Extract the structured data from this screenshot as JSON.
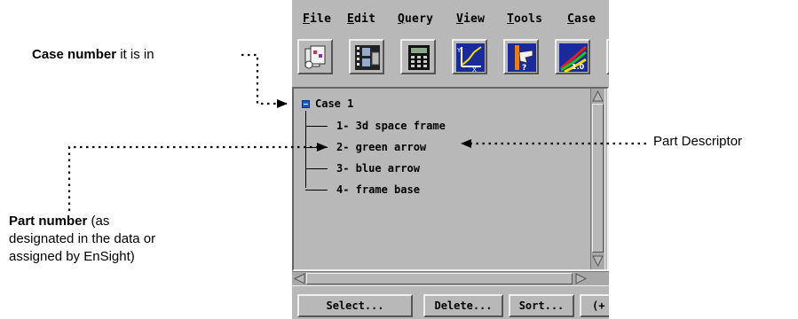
{
  "menu": [
    {
      "u": "F",
      "rest": "ile"
    },
    {
      "u": "E",
      "rest": "dit"
    },
    {
      "u": "Q",
      "rest": "uery"
    },
    {
      "u": "V",
      "rest": "iew"
    },
    {
      "u": "T",
      "rest": "ools"
    },
    {
      "u": "C",
      "rest": "ase"
    }
  ],
  "toolbar": {
    "icons": [
      "parts-icon",
      "film-icon",
      "calculator-icon",
      "plot-icon",
      "query-hand-icon",
      "colormap-icon",
      "sphere-icon"
    ]
  },
  "tree": {
    "root_label": "Case 1",
    "parts": [
      "1- 3d space frame",
      "2- green arrow",
      "3- blue arrow",
      "4- frame base"
    ]
  },
  "buttons": {
    "select": "Select...",
    "delete": "Delete...",
    "sort": "Sort...",
    "more": "(+"
  },
  "annotations": {
    "case_bold": "Case number",
    "case_rest": " it is in",
    "part_descriptor": "Part Descriptor",
    "part_bold": "Part number",
    "part_rest_1": " (as",
    "part_rest_2": "designated in the data or",
    "part_rest_3": "assigned by EnSight)"
  },
  "colors": {
    "panel_bg": "#b8b8b8",
    "tree_collapse": "#1a56c8"
  }
}
